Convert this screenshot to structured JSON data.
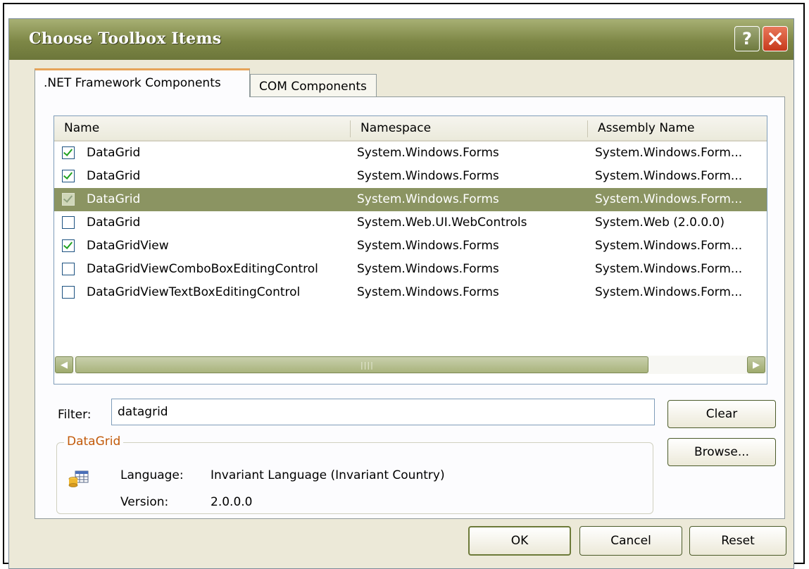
{
  "window": {
    "title": "Choose Toolbox Items",
    "help_label": "?"
  },
  "tabs": [
    {
      "label": ".NET Framework Components",
      "active": true
    },
    {
      "label": "COM Components",
      "active": false
    }
  ],
  "list": {
    "columns": [
      "Name",
      "Namespace",
      "Assembly Name"
    ],
    "rows": [
      {
        "checked": true,
        "selected": false,
        "name": "DataGrid",
        "namespace": "System.Windows.Forms",
        "assembly": "System.Windows.Form..."
      },
      {
        "checked": true,
        "selected": false,
        "name": "DataGrid",
        "namespace": "System.Windows.Forms",
        "assembly": "System.Windows.Form..."
      },
      {
        "checked": true,
        "selected": true,
        "name": "DataGrid",
        "namespace": "System.Windows.Forms",
        "assembly": "System.Windows.Form..."
      },
      {
        "checked": false,
        "selected": false,
        "name": "DataGrid",
        "namespace": "System.Web.UI.WebControls",
        "assembly": "System.Web (2.0.0.0)"
      },
      {
        "checked": true,
        "selected": false,
        "name": "DataGridView",
        "namespace": "System.Windows.Forms",
        "assembly": "System.Windows.Form..."
      },
      {
        "checked": false,
        "selected": false,
        "name": "DataGridViewComboBoxEditingControl",
        "namespace": "System.Windows.Forms",
        "assembly": "System.Windows.Form..."
      },
      {
        "checked": false,
        "selected": false,
        "name": "DataGridViewTextBoxEditingControl",
        "namespace": "System.Windows.Forms",
        "assembly": "System.Windows.Form..."
      }
    ]
  },
  "filter": {
    "label": "Filter:",
    "value": "datagrid"
  },
  "details": {
    "group_title": "DataGrid",
    "language_label": "Language:",
    "language_value": "Invariant Language (Invariant Country)",
    "version_label": "Version:",
    "version_value": "2.0.0.0"
  },
  "buttons": {
    "clear": "Clear",
    "browse": "Browse...",
    "ok": "OK",
    "cancel": "Cancel",
    "reset": "Reset"
  },
  "colors": {
    "titlebar": "#7d8746",
    "selection": "#8b9462",
    "group_title": "#c25a0a",
    "checkmark": "#21a121"
  }
}
